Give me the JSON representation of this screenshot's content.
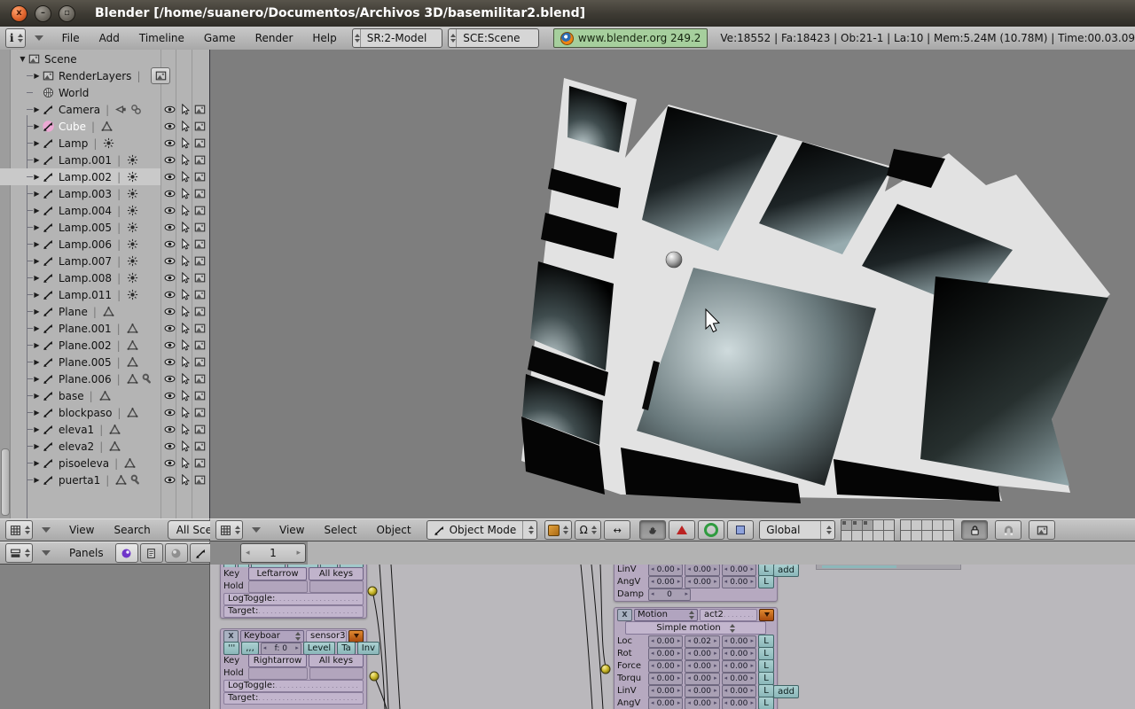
{
  "window": {
    "title": "Blender [/home/suanero/Documentos/Archivos 3D/basemilitar2.blend]",
    "buttons": {
      "close": "x",
      "minimize": "–",
      "maximize": "▫"
    }
  },
  "topbar": {
    "menus": [
      "File",
      "Add",
      "Timeline",
      "Game",
      "Render",
      "Help"
    ],
    "screen_selector": "SR:2-Model",
    "scene_selector": "SCE:Scene",
    "close_label": "X",
    "version_badge": "www.blender.org 249.2",
    "stats": "Ve:18552 | Fa:18423 | Ob:21-1 | La:10  | Mem:5.24M (10.78M)  | Time:00.03.09"
  },
  "outliner": {
    "header": {
      "menus": [
        "View",
        "Search"
      ],
      "scenes_button": "All Scenes"
    },
    "rows": [
      {
        "label": "Scene",
        "icon": "scene",
        "expand": "open",
        "indent": 0
      },
      {
        "label": "RenderLayers",
        "icon": "image",
        "expand": "closed",
        "indent": 1,
        "pipe": true,
        "render_btn": true
      },
      {
        "label": "World",
        "icon": "world",
        "expand": "none",
        "indent": 1
      },
      {
        "label": "Camera",
        "icon": "obj",
        "expand": "closed",
        "indent": 1,
        "pipe": true,
        "types": [
          "camera",
          "chain"
        ],
        "cols": true
      },
      {
        "label": "Cube",
        "icon": "obj",
        "expand": "closed",
        "indent": 1,
        "pipe": true,
        "types": [
          "mesh"
        ],
        "cols": true,
        "selected": true
      },
      {
        "label": "Lamp",
        "icon": "obj",
        "expand": "closed",
        "indent": 1,
        "pipe": true,
        "types": [
          "lamp"
        ],
        "cols": true
      },
      {
        "label": "Lamp.001",
        "icon": "obj",
        "expand": "closed",
        "indent": 1,
        "pipe": true,
        "types": [
          "lamp"
        ],
        "cols": true
      },
      {
        "label": "Lamp.002",
        "icon": "obj",
        "expand": "closed",
        "indent": 1,
        "pipe": true,
        "types": [
          "lamp"
        ],
        "cols": true,
        "highlight": true
      },
      {
        "label": "Lamp.003",
        "icon": "obj",
        "expand": "closed",
        "indent": 1,
        "pipe": true,
        "types": [
          "lamp"
        ],
        "cols": true
      },
      {
        "label": "Lamp.004",
        "icon": "obj",
        "expand": "closed",
        "indent": 1,
        "pipe": true,
        "types": [
          "lamp"
        ],
        "cols": true
      },
      {
        "label": "Lamp.005",
        "icon": "obj",
        "expand": "closed",
        "indent": 1,
        "pipe": true,
        "types": [
          "lamp"
        ],
        "cols": true
      },
      {
        "label": "Lamp.006",
        "icon": "obj",
        "expand": "closed",
        "indent": 1,
        "pipe": true,
        "types": [
          "lamp"
        ],
        "cols": true
      },
      {
        "label": "Lamp.007",
        "icon": "obj",
        "expand": "closed",
        "indent": 1,
        "pipe": true,
        "types": [
          "lamp"
        ],
        "cols": true
      },
      {
        "label": "Lamp.008",
        "icon": "obj",
        "expand": "closed",
        "indent": 1,
        "pipe": true,
        "types": [
          "lamp"
        ],
        "cols": true
      },
      {
        "label": "Lamp.011",
        "icon": "obj",
        "expand": "closed",
        "indent": 1,
        "pipe": true,
        "types": [
          "lamp"
        ],
        "cols": true
      },
      {
        "label": "Plane",
        "icon": "obj",
        "expand": "closed",
        "indent": 1,
        "pipe": true,
        "types": [
          "mesh"
        ],
        "cols": true
      },
      {
        "label": "Plane.001",
        "icon": "obj",
        "expand": "closed",
        "indent": 1,
        "pipe": true,
        "types": [
          "mesh"
        ],
        "cols": true
      },
      {
        "label": "Plane.002",
        "icon": "obj",
        "expand": "closed",
        "indent": 1,
        "pipe": true,
        "types": [
          "mesh"
        ],
        "cols": true
      },
      {
        "label": "Plane.005",
        "icon": "obj",
        "expand": "closed",
        "indent": 1,
        "pipe": true,
        "types": [
          "mesh"
        ],
        "cols": true
      },
      {
        "label": "Plane.006",
        "icon": "obj",
        "expand": "closed",
        "indent": 1,
        "pipe": true,
        "types": [
          "mesh",
          "wrench"
        ],
        "cols": true
      },
      {
        "label": "base",
        "icon": "obj",
        "expand": "closed",
        "indent": 1,
        "pipe": true,
        "types": [
          "mesh"
        ],
        "cols": true
      },
      {
        "label": "blockpaso",
        "icon": "obj",
        "expand": "closed",
        "indent": 1,
        "pipe": true,
        "types": [
          "mesh"
        ],
        "cols": true
      },
      {
        "label": "eleva1",
        "icon": "obj",
        "expand": "closed",
        "indent": 1,
        "pipe": true,
        "types": [
          "mesh"
        ],
        "cols": true
      },
      {
        "label": "eleva2",
        "icon": "obj",
        "expand": "closed",
        "indent": 1,
        "pipe": true,
        "types": [
          "mesh"
        ],
        "cols": true
      },
      {
        "label": "pisoeleva",
        "icon": "obj",
        "expand": "closed",
        "indent": 1,
        "pipe": true,
        "types": [
          "mesh"
        ],
        "cols": true
      },
      {
        "label": "puerta1",
        "icon": "obj",
        "expand": "closed",
        "indent": 1,
        "pipe": true,
        "types": [
          "mesh",
          "wrench"
        ],
        "cols": true
      }
    ]
  },
  "viewport": {
    "menus": [
      "View",
      "Select",
      "Object"
    ],
    "mode": "Object Mode",
    "orientation": "Global"
  },
  "buttons_header": {
    "panels_label": "Panels",
    "frame": "1",
    "context_icons": [
      {
        "icon": "logic",
        "active": true
      },
      {
        "icon": "script"
      },
      {
        "icon": "shading"
      },
      {
        "icon": "object"
      },
      {
        "icon": "editing"
      },
      {
        "icon": "render"
      }
    ]
  },
  "logic": {
    "sensor_partial": {
      "key_label": "Key",
      "key": "Leftarrow",
      "allkeys": "All keys",
      "hold": "Hold",
      "logtoggle": "LogToggle:",
      "target": "Target:"
    },
    "sensor2": {
      "close": "X",
      "type": "Keyboar",
      "name": "sensor3",
      "pulse1": "'''",
      "pulse2": ",,,",
      "freq": "f: 0",
      "level": "Level",
      "tap": "Ta",
      "inv": "Inv",
      "key_label": "Key",
      "key": "Rightarrow",
      "allkeys": "All keys",
      "hold": "Hold",
      "logtoggle": "LogToggle:",
      "target": "Target:"
    },
    "actuator_partial": {
      "rows": [
        {
          "label": "LinV",
          "v": [
            "0.00",
            "0.00",
            "0.00"
          ],
          "l": "L",
          "add": "add"
        },
        {
          "label": "AngV",
          "v": [
            "0.00",
            "0.00",
            "0.00"
          ],
          "l": "L"
        },
        {
          "label": "Damp",
          "single": "0"
        }
      ]
    },
    "actuator2": {
      "close": "X",
      "type": "Motion",
      "name": "act2",
      "mode": "Simple motion",
      "rows": [
        {
          "label": "Loc",
          "v": [
            "0.00",
            "0.02",
            "0.00"
          ],
          "l": "L"
        },
        {
          "label": "Rot",
          "v": [
            "0.00",
            "0.00",
            "0.00"
          ],
          "l": "L"
        },
        {
          "label": "Force",
          "v": [
            "0.00",
            "0.00",
            "0.00"
          ],
          "l": "L"
        },
        {
          "label": "Torqu",
          "v": [
            "0.00",
            "0.00",
            "0.00"
          ],
          "l": "L"
        },
        {
          "label": "LinV",
          "v": [
            "0.00",
            "0.00",
            "0.00"
          ],
          "l": "L",
          "add": "add"
        },
        {
          "label": "AngV",
          "v": [
            "0.00",
            "0.00",
            "0.00"
          ],
          "l": "L"
        }
      ]
    }
  },
  "colors": {
    "badge_green": "#a6cf9d",
    "header_gray": "#b0b0b0",
    "viewport_gray": "#7e7e7e",
    "brick_lavender": "#b6a9c0",
    "teal_button": "#8cb8ba",
    "orange_dropdown": "#c05a12",
    "selected_object_text": "#ffffff"
  }
}
